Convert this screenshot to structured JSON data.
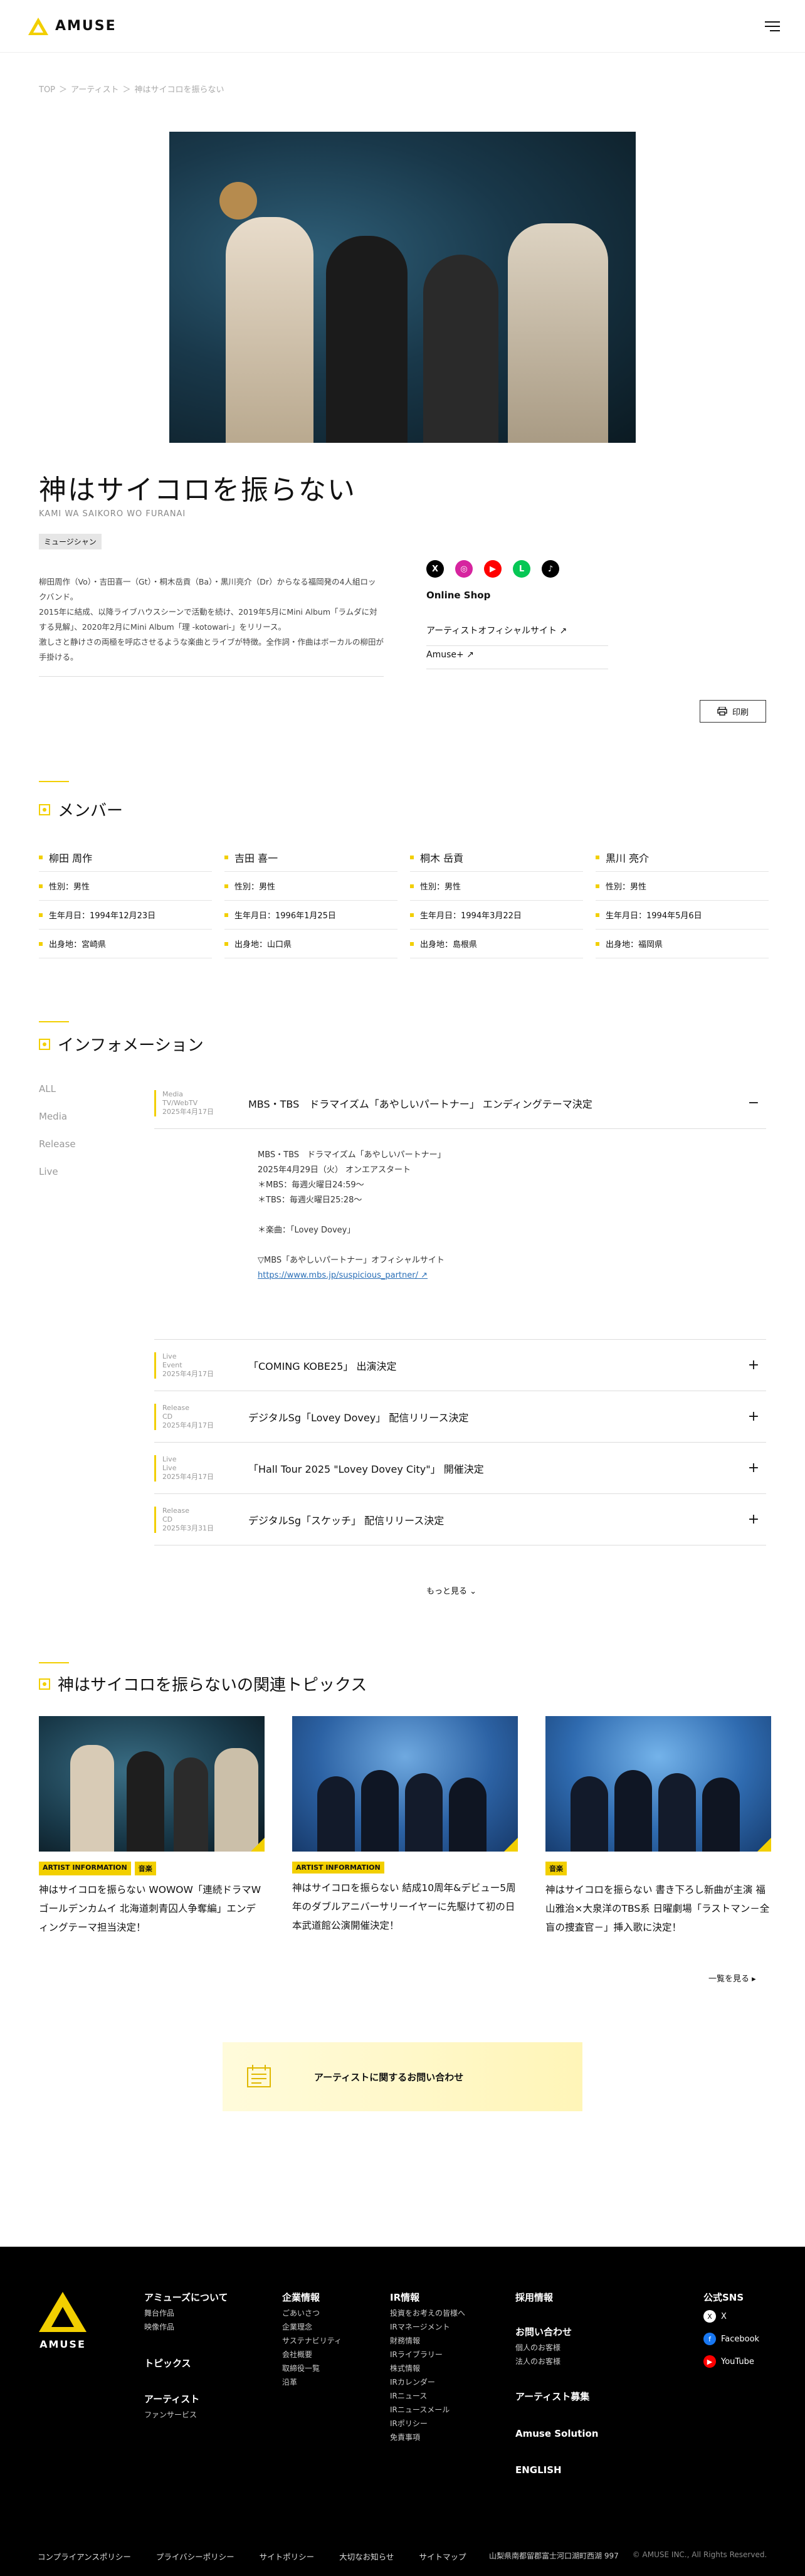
{
  "header": {
    "logo": "AMUSE",
    "menu_icon": "hamburger-icon"
  },
  "breadcrumb": [
    "TOP",
    "＞",
    "アーティスト",
    "＞",
    "神はサイコロを振らない"
  ],
  "artist": {
    "name": "神はサイコロを振らない",
    "romaji": "KAMI WA SAIKORO WO FURANAI",
    "genre": "ミュージシャン",
    "bio": [
      "柳田周作（Vo）・吉田喜一（Gt）・桐木岳貢（Ba）・黒川亮介（Dr）からなる福岡発の4人組ロックバンド。",
      "2015年に結成、以降ライブハウスシーンで活動を続け、2019年5月にMini Album「ラムダに対する見解」、2020年2月にMini Album「理 -kotowari-」をリリース。",
      "激しさと静けさの両極を呼応させるような楽曲とライブが特徴。全作詞・作曲はボーカルの柳田が手掛ける。"
    ]
  },
  "sns": [
    {
      "name": "x-icon",
      "label": "X",
      "color": "#000000"
    },
    {
      "name": "instagram-icon",
      "label": "◎",
      "color": "#d6249f"
    },
    {
      "name": "youtube-icon",
      "label": "▶",
      "color": "#ff0000"
    },
    {
      "name": "line-icon",
      "label": "L",
      "color": "#06c755"
    },
    {
      "name": "tiktok-icon",
      "label": "♪",
      "color": "#000000"
    }
  ],
  "shop": {
    "title": "Online Shop"
  },
  "links": {
    "official": "アーティストオフィシャルサイト ↗",
    "amuse_plus": "Amuse+ ↗"
  },
  "print": "印刷",
  "members_section": {
    "title": "メンバー"
  },
  "members": [
    {
      "name": "柳田 周作",
      "gender": "性別：男性",
      "birth": "生年月日：1994年12月23日",
      "from": "出身地：宮崎県"
    },
    {
      "name": "吉田 喜一",
      "gender": "性別：男性",
      "birth": "生年月日：1996年1月25日",
      "from": "出身地：山口県"
    },
    {
      "name": "桐木 岳貢",
      "gender": "性別：男性",
      "birth": "生年月日：1994年3月22日",
      "from": "出身地：島根県"
    },
    {
      "name": "黒川 亮介",
      "gender": "性別：男性",
      "birth": "生年月日：1994年5月6日",
      "from": "出身地：福岡県"
    }
  ],
  "info_section": {
    "title": "インフォメーション",
    "filters": [
      "ALL",
      "Media",
      "Release",
      "Live"
    ]
  },
  "info": [
    {
      "cat": "Media",
      "sub": "TV/WebTV",
      "date": "2025年4月17日",
      "title": "MBS・TBS　ドラマイズム「あやしいパートナー」 エンディングテーマ決定",
      "toggle": "−",
      "open": true,
      "detail": [
        "MBS・TBS　ドラマイズム「あやしいパートナー」",
        "2025年4月29日（火） オンエアスタート",
        "＊MBS：毎週火曜日24:59～",
        "＊TBS：毎週火曜日25:28～",
        "",
        "＊楽曲：「Lovey Dovey」",
        "",
        "▽MBS「あやしいパートナー」オフィシャルサイト"
      ],
      "link": "https://www.mbs.jp/suspicious_partner/ ↗"
    },
    {
      "cat": "Live",
      "sub": "Event",
      "date": "2025年4月17日",
      "title": "「COMING KOBE25」 出演決定",
      "toggle": "+"
    },
    {
      "cat": "Release",
      "sub": "CD",
      "date": "2025年4月17日",
      "title": "デジタルSg「Lovey Dovey」 配信リリース決定",
      "toggle": "+"
    },
    {
      "cat": "Live",
      "sub": "Live",
      "date": "2025年4月17日",
      "title": "「Hall Tour 2025 \"Lovey Dovey City\"」 開催決定",
      "toggle": "+"
    },
    {
      "cat": "Release",
      "sub": "CD",
      "date": "2025年3月31日",
      "title": "デジタルSg「スケッチ」 配信リリース決定",
      "toggle": "+"
    }
  ],
  "more": "もっと見る ⌄",
  "topics_section": {
    "title": "神はサイコロを振らないの関連トピックス"
  },
  "topics": [
    {
      "badges": [
        "ARTIST INFORMATION",
        "音楽"
      ],
      "text": "神はサイコロを振らない WOWOW「連続ドラマW ゴールデンカムイ 北海道刺青囚人争奪編」エンディングテーマ担当決定！"
    },
    {
      "badges": [
        "ARTIST INFORMATION"
      ],
      "text": "神はサイコロを振らない 結成10周年&デビュー5周年のダブルアニバーサリーイヤーに先駆けて初の日本武道館公演開催決定！"
    },
    {
      "badges": [
        "音楽"
      ],
      "text": "神はサイコロを振らない 書き下ろし新曲が主演 福山雅治×大泉洋のTBS系 日曜劇場「ラストマン－全盲の捜査官－」挿入歌に決定！"
    }
  ],
  "all_posts": "一覧を見る ▸",
  "contact_banner": "アーティストに関するお問い合わせ",
  "footer": {
    "logo": "AMUSE",
    "about": {
      "title": "アミューズについて",
      "items": [
        "舞台作品",
        "映像作品"
      ]
    },
    "topics": "トピックス",
    "artist": {
      "title": "アーティスト",
      "items": [
        "ファンサービス"
      ]
    },
    "company": {
      "title": "企業情報",
      "items": [
        "ごあいさつ",
        "企業理念",
        "サステナビリティ",
        "会社概要",
        "取締役一覧",
        "沿革"
      ]
    },
    "ir": {
      "title": "IR情報",
      "items": [
        "投資をお考えの皆様へ",
        "IRマネージメント",
        "財務情報",
        "IRライブラリー",
        "株式情報",
        "IRカレンダー",
        "IRニュース",
        "IRニュースメール",
        "IRポリシー",
        "免責事項"
      ]
    },
    "recruit": "採用情報",
    "contact": {
      "title": "お問い合わせ",
      "items": [
        "個人のお客様",
        "法人のお客様"
      ]
    },
    "artist_recruit": "アーティスト募集",
    "solution": "Amuse Solution",
    "english": "ENGLISH",
    "sns": {
      "title": "公式SNS",
      "items": [
        {
          "icon": "x-icon",
          "label": "X"
        },
        {
          "icon": "facebook-icon",
          "label": "Facebook"
        },
        {
          "icon": "youtube-icon",
          "label": "YouTube"
        }
      ]
    },
    "bottom": [
      "コンプライアンスポリシー",
      "プライバシーポリシー",
      "サイトポリシー",
      "大切なお知らせ",
      "サイトマップ"
    ],
    "address": "山梨県南都留郡富士河口湖町西湖 997",
    "copyright": "© AMUSE INC., All Rights Reserved."
  }
}
